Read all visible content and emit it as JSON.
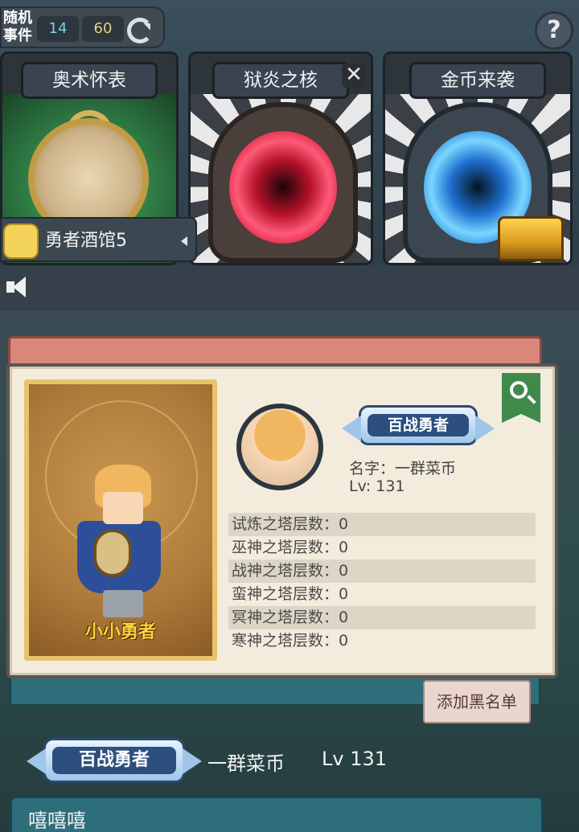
{
  "topbar": {
    "event_label": "随机事件",
    "count_current": "14",
    "count_max": "60",
    "refresh_icon": "refresh-icon",
    "help_icon": "?"
  },
  "cards": [
    {
      "title": "奥术怀表",
      "art": "pocket-watch"
    },
    {
      "title": "狱炎之核",
      "art": "red-portal",
      "close_icon": "✕"
    },
    {
      "title": "金币来袭",
      "art": "blue-portal-with-treasure-chest"
    }
  ],
  "tavern": {
    "label": "勇者酒馆5",
    "icon": "users-icon"
  },
  "profile": {
    "portrait_name": "小小勇者",
    "title_badge": "百战勇者",
    "name_line": "名字：一群菜币",
    "level_line": "Lv: 131",
    "towers": [
      "试炼之塔层数：0",
      "巫神之塔层数：0",
      "战神之塔层数：0",
      "蛮神之塔层数：0",
      "冥神之塔层数：0",
      "寒神之塔层数：0"
    ],
    "search_icon": "search-icon"
  },
  "blacklist_button": "添加黑名单",
  "chat": {
    "badge": "百战勇者",
    "name": "一群菜币",
    "level": "Lv 131",
    "message": "嘻嘻嘻"
  }
}
